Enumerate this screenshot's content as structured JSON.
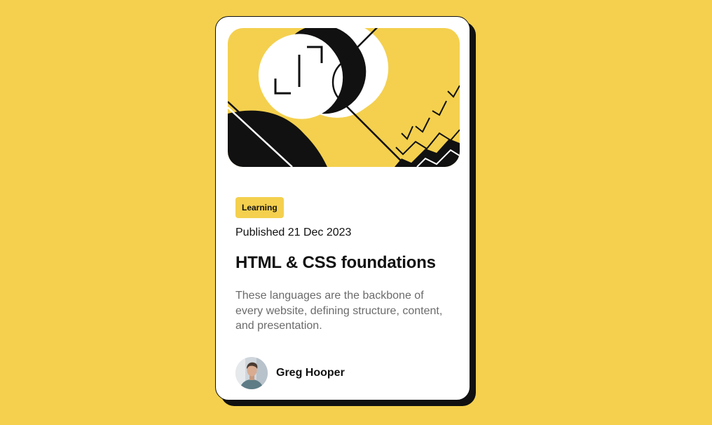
{
  "card": {
    "hero_image": "illustration-article",
    "tag": "Learning",
    "published": "Published 21 Dec 2023",
    "title": "HTML & CSS foundations",
    "description": "These languages are the backbone of every website, defining structure, content, and presentation."
  },
  "author": {
    "avatar": "avatar-image",
    "name": "Greg Hooper"
  },
  "colors": {
    "background": "#f4d04e",
    "card": "#ffffff",
    "ink": "#111111",
    "muted": "#6b6b6b"
  }
}
